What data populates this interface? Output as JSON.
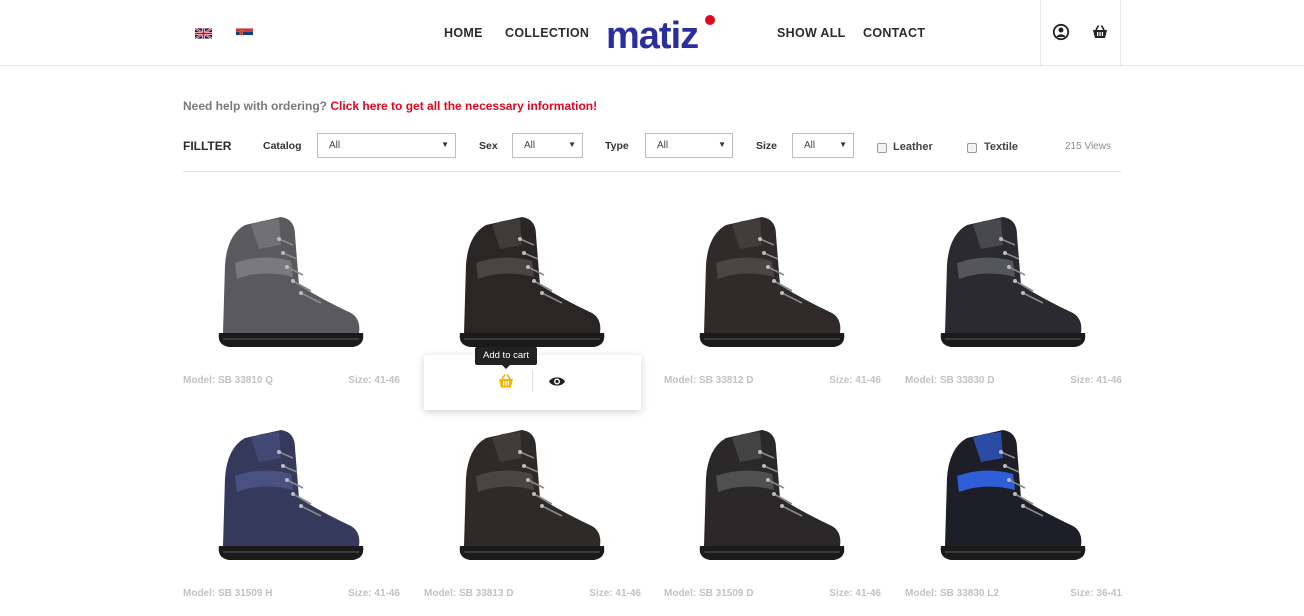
{
  "header": {
    "languages": [
      "English",
      "Serbian"
    ],
    "nav_left": [
      "HOME",
      "COLLECTION"
    ],
    "logo": "matiz",
    "nav_right": [
      "SHOW ALL",
      "CONTACT"
    ],
    "icons": [
      "user-icon",
      "shopping-bag-icon"
    ]
  },
  "help": {
    "question": "Need help with ordering?",
    "link": "Click here to get all the necessary information!"
  },
  "filter": {
    "title": "FILLTER",
    "catalog_label": "Catalog",
    "catalog_value": "All",
    "sex_label": "Sex",
    "sex_value": "All",
    "type_label": "Type",
    "type_value": "All",
    "size_label": "Size",
    "size_value": "All",
    "leather_label": "Leather",
    "textile_label": "Textile",
    "views": "215 Views"
  },
  "products": [
    {
      "model": "Model: SB 33810 Q",
      "size": "Size: 41-46",
      "color": "#5a5a5e",
      "accent": "#7a7a7e"
    },
    {
      "model": "",
      "size": "",
      "color": "#2a2626",
      "accent": "#4a4444"
    },
    {
      "model": "Model: SB 33812 D",
      "size": "Size: 41-46",
      "color": "#302a2a",
      "accent": "#4d4545"
    },
    {
      "model": "Model: SB 33830 D",
      "size": "Size: 41-46",
      "color": "#2a2a30",
      "accent": "#55555c"
    },
    {
      "model": "Model: SB 31509 H",
      "size": "Size: 41-46",
      "color": "#353a5c",
      "accent": "#4a5080"
    },
    {
      "model": "Model: SB 33813 D",
      "size": "Size: 41-46",
      "color": "#2e2a28",
      "accent": "#4a4542"
    },
    {
      "model": "Model: SB 31509 D",
      "size": "Size: 41-46",
      "color": "#2a2828",
      "accent": "#505050"
    },
    {
      "model": "Model: SB 33830 L2",
      "size": "Size: 36-41",
      "color": "#1e1e28",
      "accent": "#2f5fd8"
    }
  ],
  "action": {
    "tooltip": "Add to cart",
    "icons": [
      "cart-basket-icon",
      "eye-icon"
    ]
  },
  "colors": {
    "logo_blue": "#2b2f9e",
    "logo_red": "#e3061f",
    "help_red": "#e3061f",
    "cart_yellow": "#f2b705"
  }
}
